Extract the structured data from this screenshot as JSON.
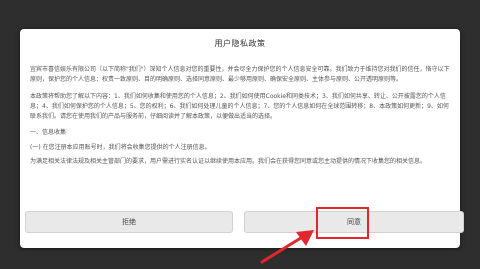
{
  "dialog": {
    "title": "用户隐私政策",
    "paragraphs": [
      "宜宾市喜信娱乐有限公司（以下简称\"我们\"）深知个人信息对您的重要性，并会尽全力保护您的个人信息安全可靠。我们致力于维持您对我们的信任，恪守以下原则，保护您的个人信息：权责一致原则、目的明确原则、选择同意原则、最少够用原则、确保安全原则、主体参与原则、公开透明原则等。",
      "本政策将帮助您了解以下内容：1、我们如何收集和使用您的个人信息；2、我们如何使用Cookie和同类技术；3、我们如何共享、转让、公开披露您的个人信息；4、我们如何保护您的个人信息；5、您的权利；6、我们如何处理儿童的个人信息；7、您的个人信息如何在全球范围转移；8、本政策如何更新；9、如何联系我们。请您在使用我们的产品与服务前，仔细阅读并了解本政策，以便做出适当的选择。",
      "一、信息收集",
      "(一) 在您注册本应用账号时，我们将会收集您提供的个人注册信息。",
      "为满足相关法律法规及相关主管部门的要求，用户需进行实名认证以继续使用本应用。我们会在获得您同意或您主动提供的情况下收集您的相关信息。"
    ]
  },
  "buttons": {
    "reject_label": "拒绝",
    "agree_label": "同意"
  },
  "annotation": {
    "highlight_color": "#e3262b"
  }
}
